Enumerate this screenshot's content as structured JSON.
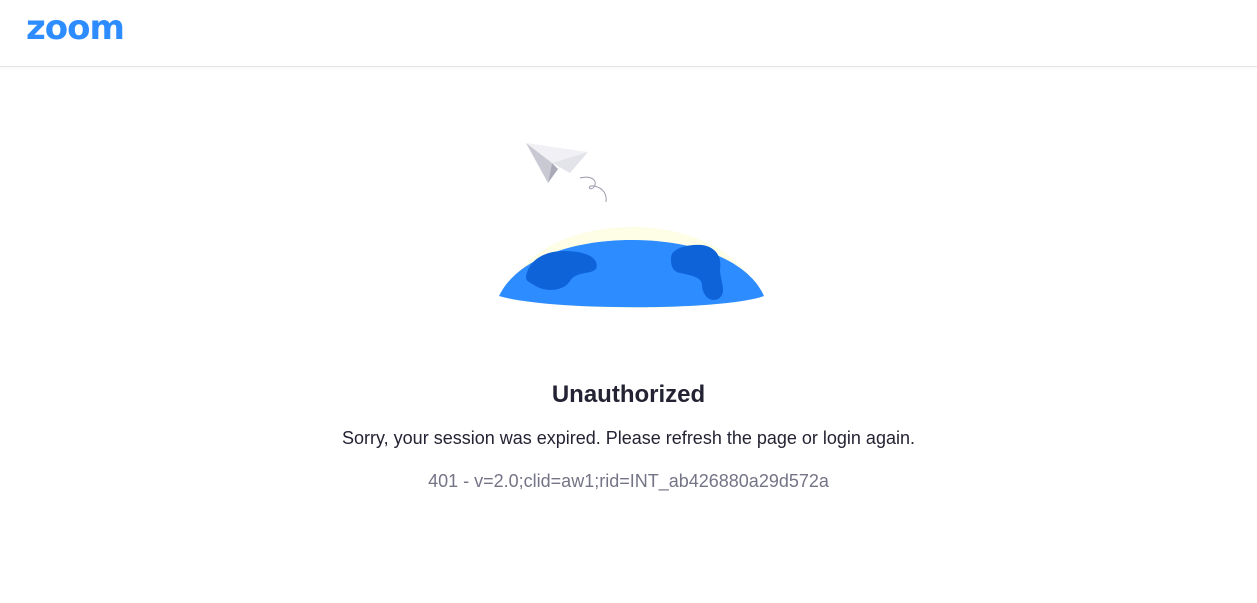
{
  "header": {
    "logo_text": "zoom"
  },
  "error": {
    "title": "Unauthorized",
    "message": "Sorry, your session was expired. Please refresh the page or login again.",
    "code": "401 - v=2.0;clid=aw1;rid=INT_ab426880a29d572a"
  },
  "colors": {
    "brand": "#2D8CFF",
    "globe": "#2D8CFF",
    "continent": "#0E63D9",
    "glow": "#FEFEE8",
    "title_text": "#232333",
    "secondary_text": "#747487"
  },
  "icons": [
    "zoom-logo",
    "paper-plane-icon",
    "globe-illustration"
  ]
}
